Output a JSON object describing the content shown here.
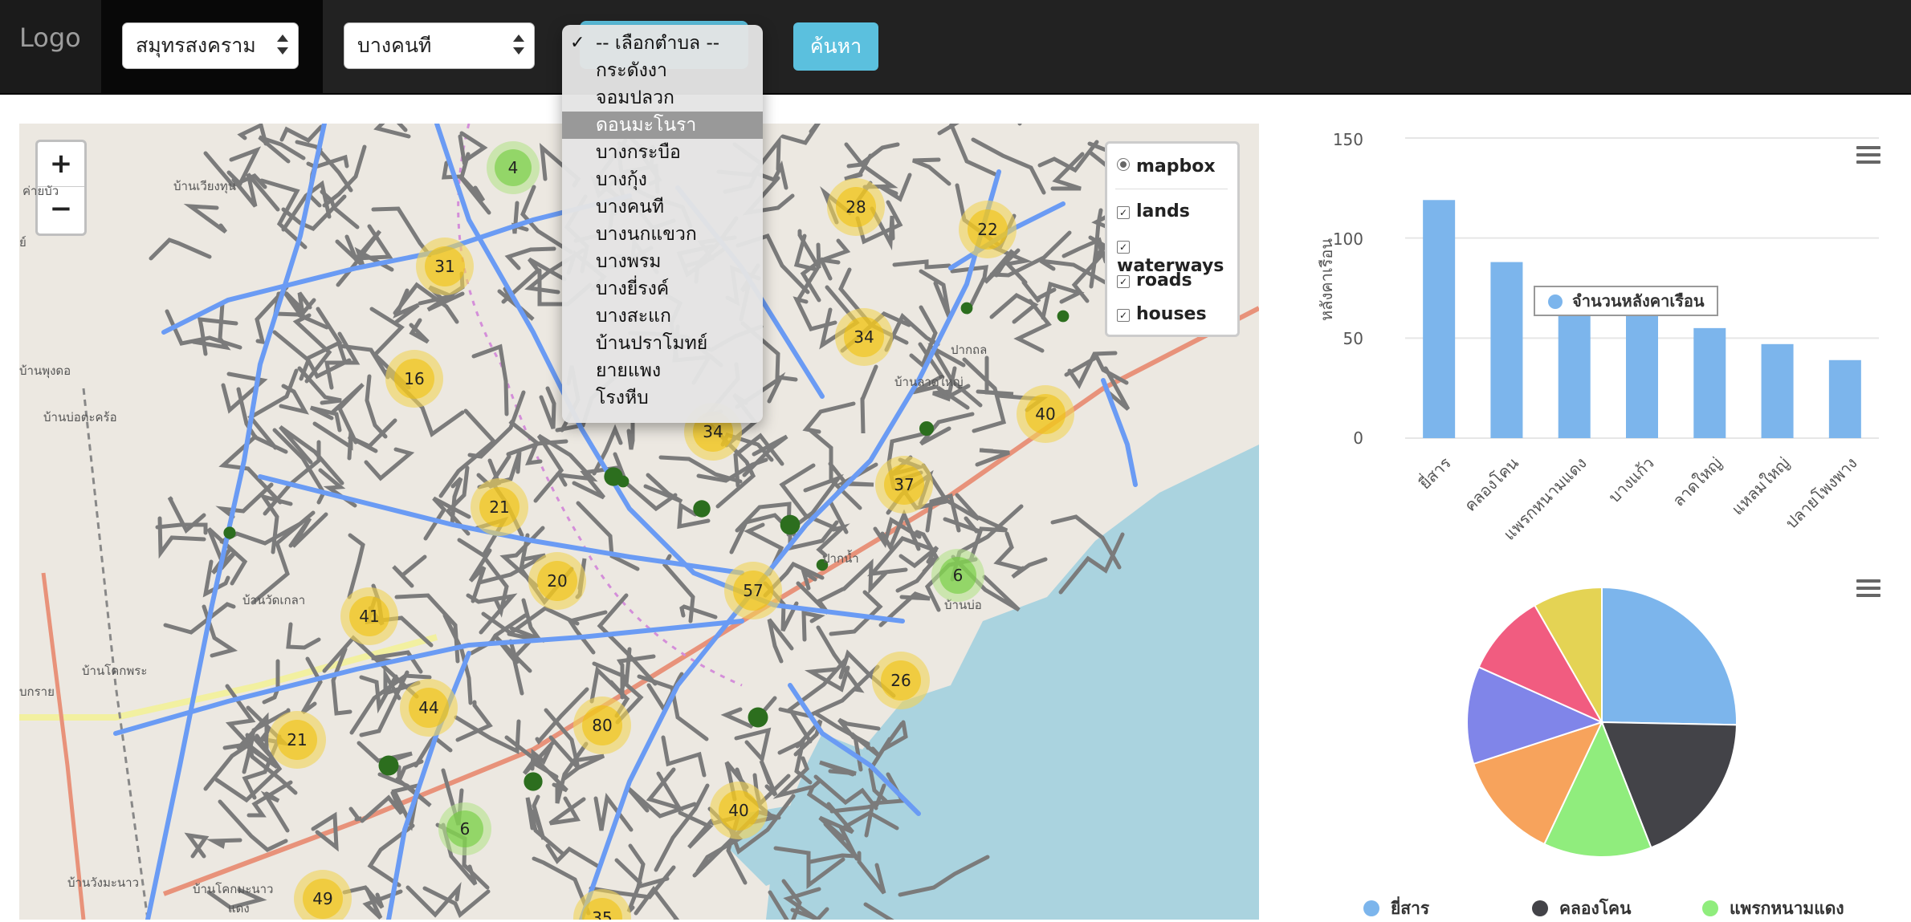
{
  "navbar": {
    "logo": "Logo",
    "province_select": "สมุทรสงคราม",
    "district_select": "บางคนที",
    "search_button": "ค้นหา"
  },
  "subdistrict_dropdown": {
    "options": [
      "-- เลือกตำบล --",
      "กระดังงา",
      "จอมปลวก",
      "ดอนมะโนรา",
      "บางกระบือ",
      "บางกุ้ง",
      "บางคนที",
      "บางนกแขวก",
      "บางพรม",
      "บางยี่รงค์",
      "บางสะแก",
      "บ้านปราโมทย์",
      "ยายแพง",
      "โรงหีบ"
    ],
    "checked": "-- เลือกตำบล --",
    "highlighted": "ดอนมะโนรา"
  },
  "map": {
    "zoom_in": "+",
    "zoom_out": "−",
    "layers": {
      "base": "mapbox",
      "overlays": [
        {
          "name": "lands",
          "checked": true
        },
        {
          "name": "waterways",
          "checked": true
        },
        {
          "name": "roads",
          "checked": true
        },
        {
          "name": "houses",
          "checked": true
        }
      ]
    },
    "clusters": [
      "4",
      "28",
      "22",
      "31",
      "34",
      "16",
      "40",
      "34",
      "37",
      "21",
      "20",
      "57",
      "6",
      "41",
      "26",
      "44",
      "80",
      "21",
      "40",
      "6",
      "49",
      "35"
    ],
    "place_labels": [
      "ค่ายบัว",
      "บ้านเวียงทุน",
      "ย์",
      "บ้านพุงดอ",
      "บ้านบ่อตะคร้อ",
      "บ้านวัดเกลา",
      "บ้านโคกพระ",
      "บกราย",
      "บ้านวังมะนาว",
      "บ้านโคกมะนาว",
      "แดง",
      "บ้านบ่อ",
      "ปากน้ำ",
      "ปากถล",
      "บ้านลาดใหญ่"
    ],
    "colors": {
      "cluster_large": "#f1d357",
      "cluster_small": "#b5e28c",
      "roads": "#7b7b7b",
      "waterways": "#6a9bf4",
      "sea": "#aad3df"
    }
  },
  "bar_chart": {
    "menu_icon": "hamburger-icon",
    "y_axis_title": "หลังคาเรือน",
    "y_ticks": [
      "150",
      "100",
      "50",
      "0"
    ],
    "tooltip": "จำนวนหลังคาเรือน",
    "color": "#7cb5ec"
  },
  "pie_chart": {
    "menu_icon": "hamburger-icon",
    "legend": [
      {
        "name": "ยี่สาร",
        "color": "#7cb5ec"
      },
      {
        "name": "คลองโคน",
        "color": "#434348"
      },
      {
        "name": "แพรกหนามแดง",
        "color": "#90ed7d"
      }
    ]
  },
  "chart_data": [
    {
      "type": "bar",
      "categories": [
        "ยี่สาร",
        "คลองโคน",
        "แพรกหนามแดง",
        "บางแก้ว",
        "ลาดใหญ่",
        "แหลมใหญ่",
        "ปลายโพงพาง"
      ],
      "values": [
        119,
        88,
        61,
        61,
        55,
        47,
        39
      ],
      "title": "",
      "xlabel": "",
      "ylabel": "หลังคาเรือน",
      "ylim": [
        0,
        150
      ],
      "series": [
        {
          "name": "จำนวนหลังคาเรือน",
          "values": [
            119,
            88,
            61,
            61,
            55,
            47,
            39
          ]
        }
      ],
      "grid": true
    },
    {
      "type": "pie",
      "categories": [
        "ยี่สาร",
        "คลองโคน",
        "แพรกหนามแดง",
        "บางแก้ว",
        "ลาดใหญ่",
        "แหลมใหญ่",
        "ปลายโพงพาง"
      ],
      "values": [
        119,
        88,
        61,
        61,
        55,
        47,
        39
      ],
      "colors": [
        "#7cb5ec",
        "#434348",
        "#90ed7d",
        "#f7a35c",
        "#8085e9",
        "#f15c80",
        "#e4d354"
      ],
      "legend": "bottom"
    }
  ]
}
